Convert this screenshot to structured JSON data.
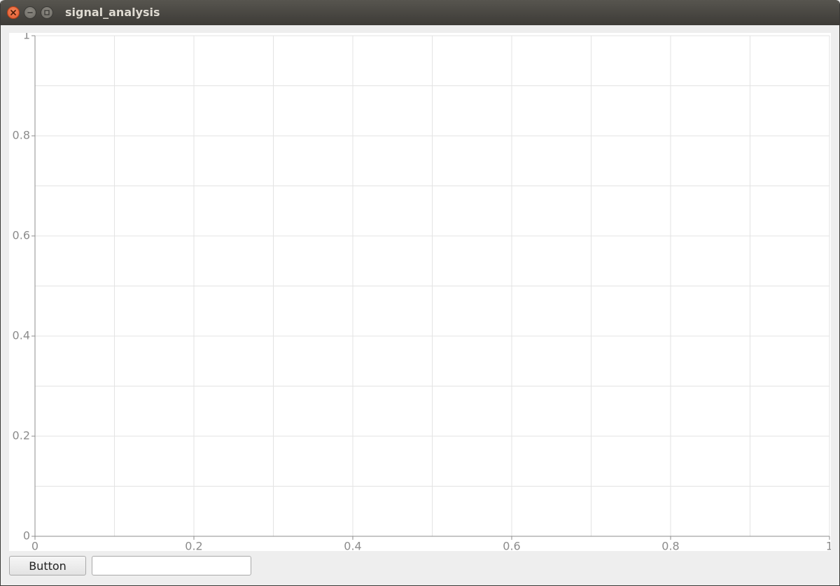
{
  "window": {
    "title": "signal_analysis"
  },
  "chart_data": {
    "type": "line",
    "series": [],
    "xlim": [
      0,
      1
    ],
    "ylim": [
      0,
      1
    ],
    "x_ticks": [
      0,
      0.2,
      0.4,
      0.6,
      0.8,
      1
    ],
    "y_ticks": [
      0,
      0.2,
      0.4,
      0.6,
      0.8,
      1
    ],
    "x_tick_labels": [
      "0",
      "0.2",
      "0.4",
      "0.6",
      "0.8",
      "1"
    ],
    "y_tick_labels": [
      "0",
      "0.2",
      "0.4",
      "0.6",
      "0.8",
      "1"
    ],
    "grid": true,
    "minor_grid_step": 0.1,
    "title": "",
    "xlabel": "",
    "ylabel": ""
  },
  "controls": {
    "button_label": "Button",
    "input_value": "",
    "input_placeholder": ""
  }
}
